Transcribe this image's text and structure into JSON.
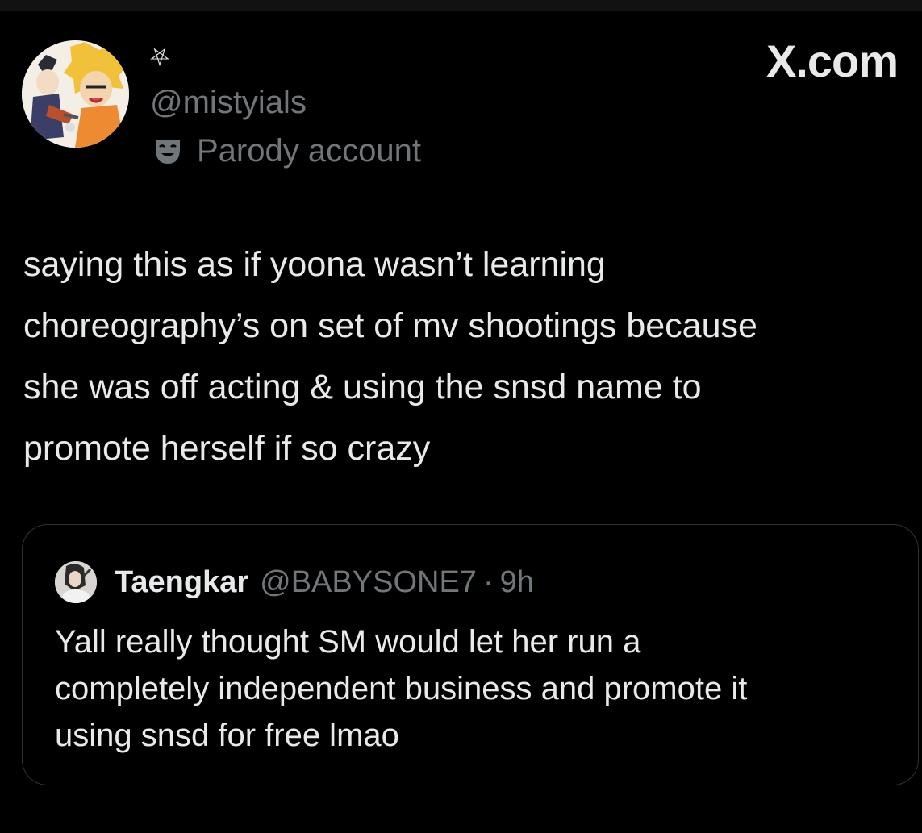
{
  "author": {
    "display_name": "⛧",
    "handle": "@mistyials",
    "label_icon": "theater-mask-icon",
    "label": "Parody account"
  },
  "site": {
    "brand": "X.com"
  },
  "tweet": {
    "lines": [
      "saying this as if yoona wasn’t learning",
      "choreography’s on set of mv shootings because",
      "she was off acting & using the snsd name to",
      "promote herself if so crazy"
    ]
  },
  "quoted_tweet": {
    "display_name": "Taengkar",
    "handle": "@BABYSONE7",
    "separator": "·",
    "time": "9h",
    "lines": [
      "Yall really thought SM would let her run a",
      "completely independent business and promote it",
      "using snsd for free lmao"
    ]
  },
  "colors": {
    "background": "#000000",
    "text_primary": "#e7e9ea",
    "text_secondary": "#71767b",
    "border": "#2f3336"
  }
}
